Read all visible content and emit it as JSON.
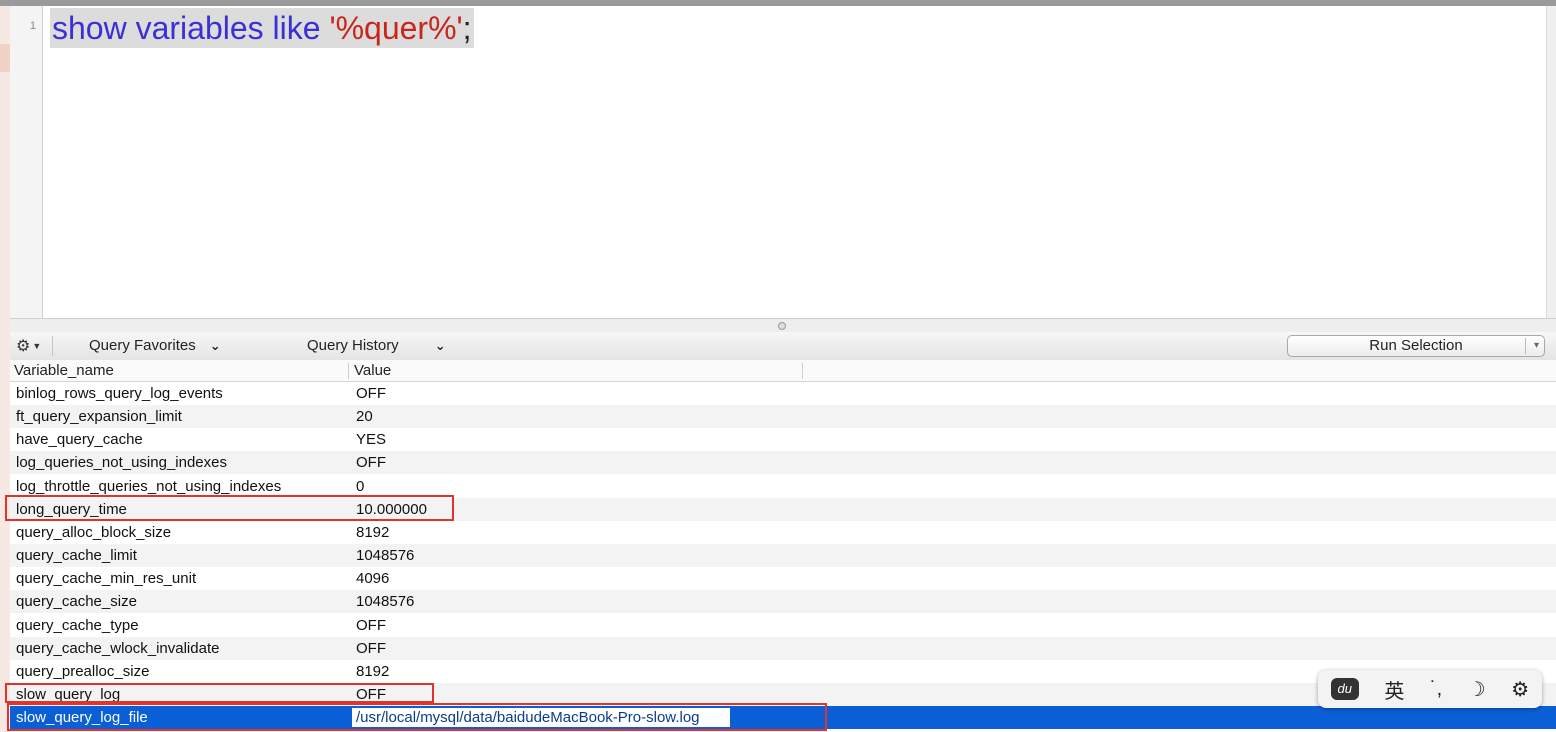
{
  "editor": {
    "line_number": "1",
    "code_keyword": "show variables like",
    "code_string": "'%quer%'",
    "code_terminator": ";"
  },
  "toolbar": {
    "gear_icon": "gear-icon",
    "query_favorites": "Query Favorites",
    "query_history": "Query History",
    "run_selection": "Run Selection"
  },
  "table": {
    "columns": [
      "Variable_name",
      "Value"
    ],
    "rows": [
      {
        "name": "binlog_rows_query_log_events",
        "value": "OFF"
      },
      {
        "name": "ft_query_expansion_limit",
        "value": "20"
      },
      {
        "name": "have_query_cache",
        "value": "YES"
      },
      {
        "name": "log_queries_not_using_indexes",
        "value": "OFF"
      },
      {
        "name": "log_throttle_queries_not_using_indexes",
        "value": "0"
      },
      {
        "name": "long_query_time",
        "value": "10.000000"
      },
      {
        "name": "query_alloc_block_size",
        "value": "8192"
      },
      {
        "name": "query_cache_limit",
        "value": "1048576"
      },
      {
        "name": "query_cache_min_res_unit",
        "value": "4096"
      },
      {
        "name": "query_cache_size",
        "value": "1048576"
      },
      {
        "name": "query_cache_type",
        "value": "OFF"
      },
      {
        "name": "query_cache_wlock_invalidate",
        "value": "OFF"
      },
      {
        "name": "query_prealloc_size",
        "value": "8192"
      },
      {
        "name": "slow_query_log",
        "value": "OFF"
      },
      {
        "name": "slow_query_log_file",
        "value": "/usr/local/mysql/data/baidudeMacBook-Pro-slow.log"
      }
    ],
    "selected_row": "slow_query_log_file"
  },
  "ime": {
    "logo": "du",
    "lang": "英",
    "punct": "˙,",
    "moon_icon": "☽",
    "gear_icon": "⚙"
  },
  "colors": {
    "keyword": "#3b2fd6",
    "string": "#c8261c",
    "selection": "#0a5fd6",
    "highlight_box": "#e0332c"
  }
}
